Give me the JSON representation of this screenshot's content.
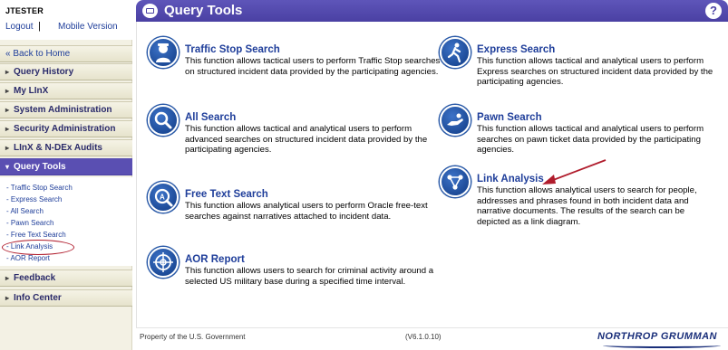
{
  "user": {
    "username": "JTESTER",
    "logout_label": "Logout",
    "divider": "|",
    "mobile_label": "Mobile Version"
  },
  "sidebar": {
    "items": [
      {
        "label": "« Back to Home"
      },
      {
        "label": "Query History"
      },
      {
        "label": "My LInX"
      },
      {
        "label": "System Administration"
      },
      {
        "label": "Security Administration"
      },
      {
        "label": "LInX & N-DEx Audits"
      },
      {
        "label": "Query Tools"
      },
      {
        "label": "Feedback"
      },
      {
        "label": "Info Center"
      }
    ],
    "subitems": [
      {
        "label": "- Traffic Stop Search"
      },
      {
        "label": "- Express Search"
      },
      {
        "label": "- All Search"
      },
      {
        "label": "- Pawn Search"
      },
      {
        "label": "- Free Text Search"
      },
      {
        "label": "- Link Analysis"
      },
      {
        "label": "- AOR Report"
      }
    ]
  },
  "header": {
    "title": "Query Tools",
    "help": "?"
  },
  "tools": [
    {
      "title": "Traffic Stop Search",
      "desc": "This function allows tactical users to perform Traffic Stop searches on structured incident data provided by the participating agencies.",
      "icon": "officer-icon"
    },
    {
      "title": "Express Search",
      "desc": "This function allows tactical and analytical users to perform Express searches on structured incident data provided by the participating agencies.",
      "icon": "running-person-icon"
    },
    {
      "title": "All Search",
      "desc": "This function allows tactical and analytical users to perform advanced searches on structured incident data provided by the participating agencies.",
      "icon": "magnifier-icon"
    },
    {
      "title": "Pawn Search",
      "desc": "This function allows tactical and analytical users to perform searches on pawn ticket data provided by the participating agencies.",
      "icon": "pawn-hand-icon"
    },
    {
      "title": "Link Analysis",
      "desc": "This function allows analytical users to search for people, addresses and phrases found in both incident data and narrative documents. The results of the search can be depicted as a link diagram.",
      "icon": "link-diagram-icon"
    },
    {
      "title": "Free Text Search",
      "desc": "This function allows analytical users to perform Oracle free-text searches against narratives attached to incident data.",
      "icon": "text-magnifier-icon"
    },
    {
      "title": "AOR Report",
      "desc": "This function allows users to search for criminal activity around a selected US military base during a specified time interval.",
      "icon": "crosshair-icon"
    }
  ],
  "footer": {
    "text": "Property of the U.S. Government",
    "version": "(V6.1.0.10)",
    "logo": "NORTHROP GRUMMAN"
  },
  "colors": {
    "accent": "#4a40a3",
    "link": "#1f3e9a",
    "annotation": "#b01c2c"
  }
}
